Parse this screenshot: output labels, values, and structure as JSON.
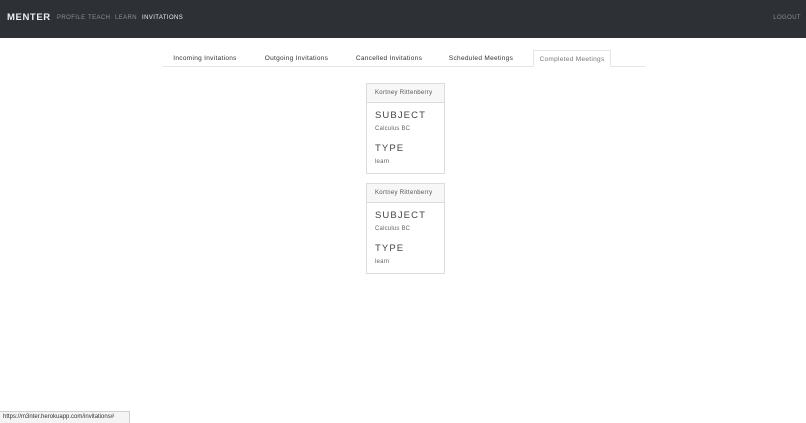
{
  "nav": {
    "brand": "MENTER",
    "links": [
      "PROFILE",
      "TEACH",
      "LEARN",
      "INVITATIONS"
    ],
    "active": "INVITATIONS",
    "logout": "LOGOUT"
  },
  "tabs": [
    {
      "label": "Incoming Invitations"
    },
    {
      "label": "Outgoing Invitations"
    },
    {
      "label": "Cancelled Invitations"
    },
    {
      "label": "Scheduled Meetings"
    },
    {
      "label": "Completed Meetings"
    }
  ],
  "active_tab": "Completed Meetings",
  "meetings": [
    {
      "name": "Kortney Rittenberry",
      "subject_heading": "SUBJECT",
      "subject": "Calculus BC",
      "type_heading": "TYPE",
      "type": "learn"
    },
    {
      "name": "Kortney Rittenberry",
      "subject_heading": "SUBJECT",
      "subject": "Calculus BC",
      "type_heading": "TYPE",
      "type": "learn"
    }
  ],
  "status_url": "https://m3nter.herokuapp.com/invitations#"
}
